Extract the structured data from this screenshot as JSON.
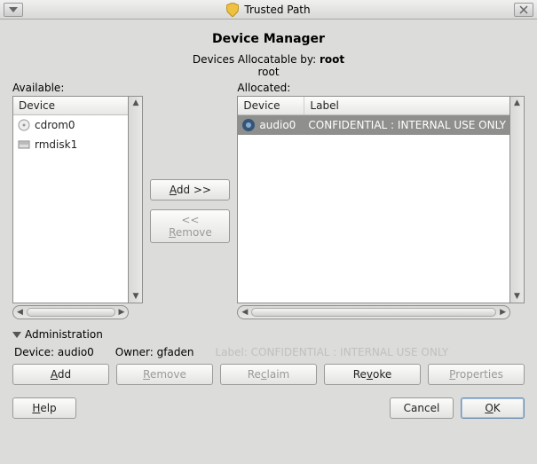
{
  "titlebar": {
    "title": "Trusted Path"
  },
  "dialog": {
    "title": "Device Manager",
    "allocatable_by_prefix": "Devices Allocatable by: ",
    "allocatable_by_user": "root",
    "allocatable_user_line": "root"
  },
  "available": {
    "label": "Available:",
    "header_device": "Device",
    "items": [
      {
        "icon": "cd-icon",
        "name": "cdrom0"
      },
      {
        "icon": "disk-icon",
        "name": "rmdisk1"
      }
    ]
  },
  "allocated": {
    "label": "Allocated:",
    "header_device": "Device",
    "header_label": "Label",
    "items": [
      {
        "icon": "audio-icon",
        "name": "audio0",
        "label": "CONFIDENTIAL : INTERNAL USE ONLY",
        "selected": true
      }
    ]
  },
  "mid": {
    "add": "Add >>",
    "remove": "<< Remove"
  },
  "admin": {
    "section_label": "Administration",
    "device_prefix": "Device: ",
    "device_value": "audio0",
    "owner_prefix": "Owner: ",
    "owner_value": "gfaden",
    "label_prefix": "Label: ",
    "label_value": "CONFIDENTIAL : INTERNAL USE ONLY",
    "buttons": {
      "add": "Add",
      "remove": "Remove",
      "reclaim": "Reclaim",
      "revoke": "Revoke",
      "properties": "Properties"
    }
  },
  "bottom": {
    "help": "Help",
    "cancel": "Cancel",
    "ok": "OK"
  }
}
